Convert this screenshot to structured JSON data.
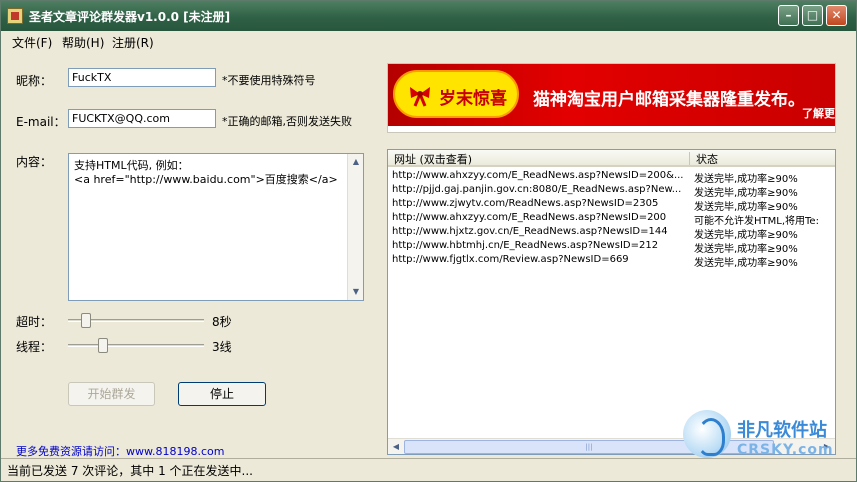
{
  "window": {
    "title": "圣者文章评论群发器v1.0.0 [未注册]",
    "buttons": {
      "minimize": "–",
      "maximize": "□",
      "close": "✕"
    }
  },
  "menu": [
    "文件(F)",
    "帮助(H)",
    "注册(R)"
  ],
  "form": {
    "nickname_label": "昵称：",
    "nickname_value": "FuckTX",
    "nickname_hint": "*不要使用特殊符号",
    "email_label": "E-mail：",
    "email_value": "FUCKTX@QQ.com",
    "email_hint": "*正确的邮箱,否则发送失败",
    "content_label": "内容：",
    "content_lines": [
      "支持HTML代码, 例如：",
      "<a href=\"http://www.baidu.com\">百度搜索</a>"
    ],
    "timeout_label": "超时：",
    "timeout_value": "8秒",
    "timeout_level": 0.1,
    "threads_label": "线程：",
    "threads_value": "3线",
    "threads_level": 0.24,
    "start_button": "开始群发",
    "stop_button": "停止",
    "more_link": "更多免费资源请访问：www.818198.com"
  },
  "banner": {
    "badge_text": "岁末惊喜",
    "headline": "猫神淘宝用户邮箱采集器隆重发布。",
    "more": "了解更"
  },
  "list": {
    "columns": [
      "网址 (双击查看)",
      "状态"
    ],
    "rows": [
      {
        "url": "http://www.ahxzyy.com/E_ReadNews.asp?NewsID=200&...",
        "status": "发送完毕,成功率≥90%"
      },
      {
        "url": "http://pjjd.gaj.panjin.gov.cn:8080/E_ReadNews.asp?New...",
        "status": "发送完毕,成功率≥90%"
      },
      {
        "url": "http://www.zjwytv.com/ReadNews.asp?NewsID=2305",
        "status": "发送完毕,成功率≥90%"
      },
      {
        "url": "http://www.ahxzyy.com/E_ReadNews.asp?NewsID=200",
        "status": "可能不允许发HTML,将用Te:"
      },
      {
        "url": "http://www.hjxtz.gov.cn/E_ReadNews.asp?NewsID=144",
        "status": "发送完毕,成功率≥90%"
      },
      {
        "url": "http://www.hbtmhj.cn/E_ReadNews.asp?NewsID=212",
        "status": "发送完毕,成功率≥90%"
      },
      {
        "url": "http://www.fjgtlx.com/Review.asp?NewsID=669",
        "status": "发送完毕,成功率≥90%"
      }
    ]
  },
  "status_bar": "当前已发送 7 次评论，其中 1 个正在发送中...",
  "watermark": {
    "cn": "非凡软件站",
    "en": "CRSKY.com"
  },
  "colors": {
    "titlebar": "#2f6146",
    "face": "#ECE9D8",
    "banner": "#e30000",
    "badge": "#ffe400"
  }
}
